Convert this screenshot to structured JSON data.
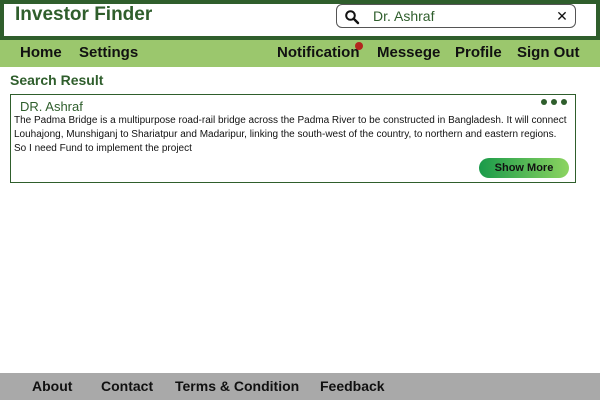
{
  "app": {
    "title": "Investor Finder"
  },
  "search": {
    "value": "Dr. Ashraf",
    "clear_glyph": "✕",
    "icon": "search-icon"
  },
  "nav": {
    "left": [
      {
        "label": "Home"
      },
      {
        "label": "Settings"
      }
    ],
    "right": [
      {
        "label": "Notification"
      },
      {
        "label": "Messege"
      },
      {
        "label": "Profile"
      },
      {
        "label": "Sign Out"
      }
    ],
    "notification_badge_color": "#b3261e"
  },
  "results": {
    "title": "Search Result",
    "items": [
      {
        "name": "DR. Ashraf",
        "description": "The Padma Bridge is a multipurpose road-rail bridge across the Padma River to be constructed in Bangladesh. It will connect Louhajong, Munshiganj to Shariatpur and Madaripur, linking the south-west of the country, to northern and eastern regions. So I need Fund to implement the project",
        "action_label": "Show More"
      }
    ]
  },
  "footer": {
    "links": [
      {
        "label": "About"
      },
      {
        "label": "Contact"
      },
      {
        "label": "Terms & Condition"
      },
      {
        "label": "Feedback"
      }
    ]
  },
  "colors": {
    "primary": "#2f5e2c",
    "nav_bg": "#9bc76d",
    "footer_bg": "#a9a9a9",
    "button_gradient_start": "#1a9a4a",
    "button_gradient_end": "#8cd460"
  }
}
